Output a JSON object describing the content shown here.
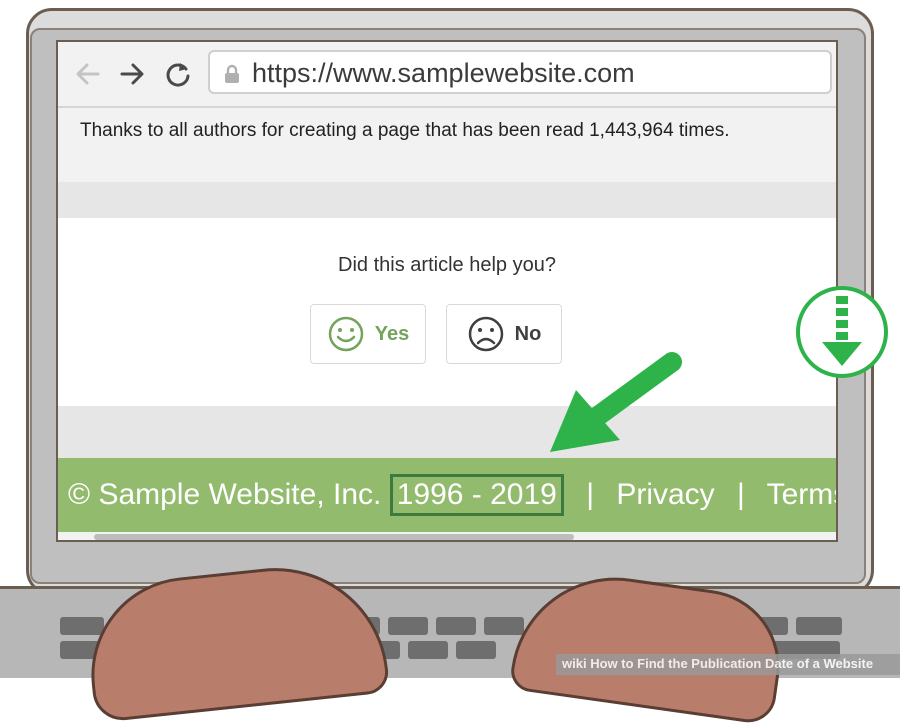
{
  "browser": {
    "url": "https://www.samplewebsite.com"
  },
  "page": {
    "thanks_text": "Thanks to all authors for creating a page that has been read 1,443,964 times.",
    "feedback": {
      "question": "Did this article help you?",
      "yes_label": "Yes",
      "no_label": "No"
    },
    "footer": {
      "company": "© Sample Website, Inc.",
      "years": "1996 - 2019",
      "separator": "|",
      "privacy_label": "Privacy",
      "terms_label": "Terms"
    }
  },
  "caption": {
    "brand": "wiki",
    "title": "How to Find the Publication Date of a Website"
  },
  "colors": {
    "footer_bg": "#93bb6e",
    "accent_green": "#2db34a",
    "highlight_box": "#3c7a3e"
  },
  "icons": [
    "back-arrow-icon",
    "forward-arrow-icon",
    "reload-icon",
    "lock-icon",
    "smiley-icon",
    "frown-icon",
    "scroll-down-icon",
    "pointer-arrow-icon"
  ]
}
